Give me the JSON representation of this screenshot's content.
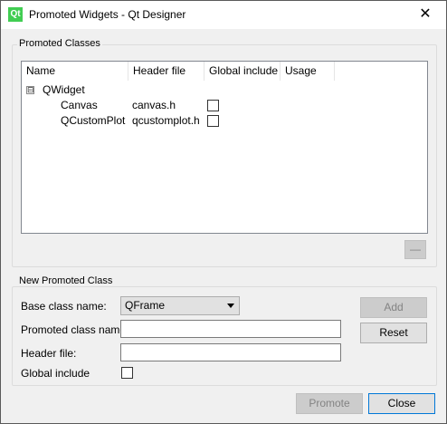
{
  "window": {
    "title": "Promoted Widgets - Qt Designer",
    "app_icon_glyph": "Qt",
    "close_glyph": "✕"
  },
  "promoted_classes": {
    "group_title": "Promoted Classes",
    "columns": [
      "Name",
      "Header file",
      "Global include",
      "Usage"
    ],
    "tree": {
      "parent": {
        "expander": "⊟",
        "name": "QWidget"
      },
      "children": [
        {
          "name": "Canvas",
          "header": "canvas.h",
          "global_include": false,
          "usage": ""
        },
        {
          "name": "QCustomPlot",
          "header": "qcustomplot.h",
          "global_include": false,
          "usage": ""
        }
      ]
    },
    "remove_button_label": "—"
  },
  "new_promoted_class": {
    "group_title": "New Promoted Class",
    "base_class_label": "Base class name:",
    "base_class_value": "QFrame",
    "promoted_class_label": "Promoted class name:",
    "promoted_class_value": "",
    "header_file_label": "Header file:",
    "header_file_value": "",
    "global_include_label": "Global include",
    "global_include_checked": false,
    "add_label": "Add",
    "reset_label": "Reset"
  },
  "footer": {
    "promote_label": "Promote",
    "close_label": "Close"
  },
  "colors": {
    "accent": "#0078d7",
    "qt_green": "#41cd52"
  }
}
